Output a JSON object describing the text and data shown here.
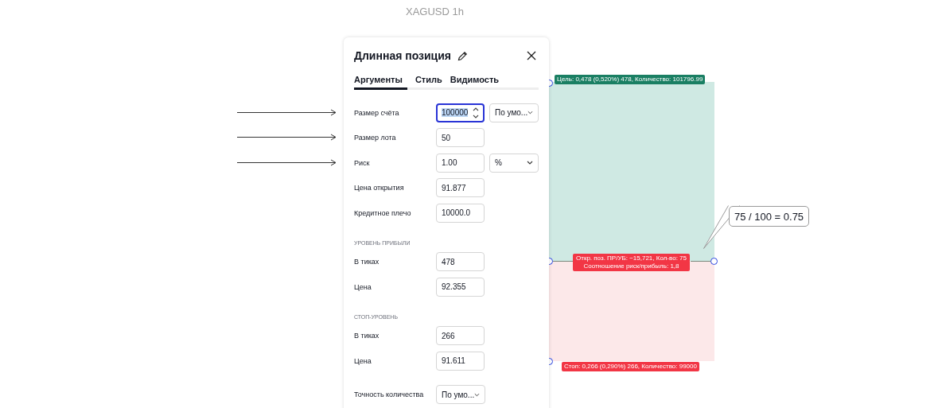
{
  "chart": {
    "title": "XAGUSD 1h",
    "target_label": "Цель: 0,478 (0,520%) 478, Количество: 101796.99",
    "position_label": [
      "Откр. поз. ПР/УБ: −15,721, Кол-во: 75",
      "Соотношение риск/прибыль: 1,8"
    ],
    "stop_label": "Стоп: 0,266 (0,290%) 266, Количество: 99000",
    "callout": "75 / 100 = 0.75"
  },
  "dialog": {
    "title": "Длинная позиция",
    "tabs": [
      {
        "label": "Аргументы",
        "selected": true
      },
      {
        "label": "Стиль",
        "selected": false
      },
      {
        "label": "Видимость",
        "selected": false
      }
    ],
    "rows": [
      {
        "kind": "field",
        "label": "Размер счёта",
        "value": "100000",
        "focused": true,
        "select": "По умо...",
        "arrow": true
      },
      {
        "kind": "field",
        "label": "Размер лота",
        "value": "50",
        "focused": false,
        "arrow": true
      },
      {
        "kind": "field",
        "label": "Риск",
        "value": "1.00",
        "focused": false,
        "select": "%",
        "arrow": true
      },
      {
        "kind": "field",
        "label": "Цена открытия",
        "value": "91.877",
        "focused": false
      },
      {
        "kind": "field",
        "label": "Кредитное плечо",
        "value": "10000.0",
        "focused": false
      },
      {
        "kind": "section",
        "label": "УРОВЕНЬ ПРИБЫЛИ"
      },
      {
        "kind": "field",
        "label": "В тиках",
        "value": "478",
        "focused": false
      },
      {
        "kind": "field",
        "label": "Цена",
        "value": "92.355",
        "focused": false
      },
      {
        "kind": "section",
        "label": "СТОП-УРОВЕНЬ"
      },
      {
        "kind": "field",
        "label": "В тиках",
        "value": "266",
        "focused": false
      },
      {
        "kind": "field",
        "label": "Цена",
        "value": "91.611",
        "focused": false
      },
      {
        "kind": "gap"
      },
      {
        "kind": "dropdown",
        "label": "Точность количества",
        "select": "По умо..."
      }
    ]
  }
}
